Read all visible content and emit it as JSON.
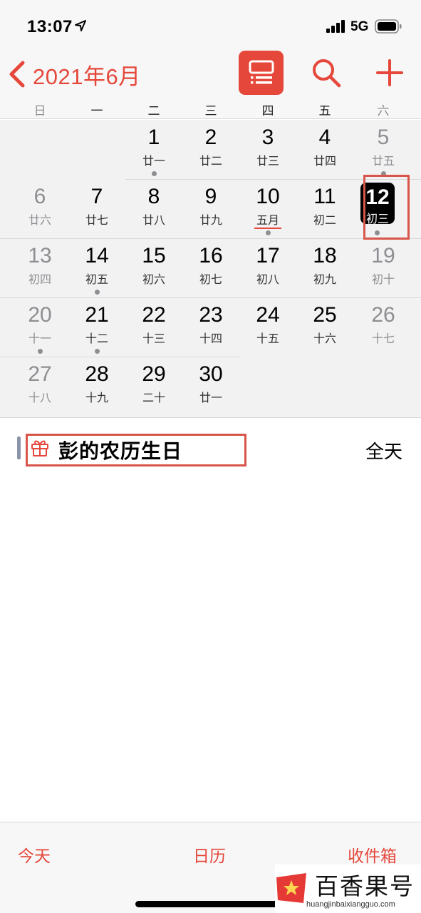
{
  "status": {
    "time": "13:07",
    "network": "5G",
    "icons": [
      "location-arrow-icon",
      "signal-bars-icon",
      "battery-icon"
    ]
  },
  "nav": {
    "title": "2021年6月",
    "icons": [
      "chevron-left-icon",
      "list-view-icon",
      "search-icon",
      "plus-icon"
    ]
  },
  "colors": {
    "accent": "#e5473a",
    "annotation": "#d9544a",
    "today_bg": "#000000",
    "weekend_text": "#8e8e93"
  },
  "weekdays": [
    "日",
    "一",
    "二",
    "三",
    "四",
    "五",
    "六"
  ],
  "days": [
    {
      "d": "1",
      "l": "廿一",
      "dot": true
    },
    {
      "d": "2",
      "l": "廿二"
    },
    {
      "d": "3",
      "l": "廿三"
    },
    {
      "d": "4",
      "l": "廿四"
    },
    {
      "d": "5",
      "l": "廿五",
      "dot": true
    },
    {
      "d": "6",
      "l": "廿六"
    },
    {
      "d": "7",
      "l": "廿七"
    },
    {
      "d": "8",
      "l": "廿八"
    },
    {
      "d": "9",
      "l": "廿九"
    },
    {
      "d": "10",
      "l": "五月",
      "dot": true,
      "underline": true
    },
    {
      "d": "11",
      "l": "初二"
    },
    {
      "d": "12",
      "l": "初三",
      "dot": true,
      "today": true
    },
    {
      "d": "13",
      "l": "初四"
    },
    {
      "d": "14",
      "l": "初五",
      "dot": true
    },
    {
      "d": "15",
      "l": "初六"
    },
    {
      "d": "16",
      "l": "初七"
    },
    {
      "d": "17",
      "l": "初八"
    },
    {
      "d": "18",
      "l": "初九"
    },
    {
      "d": "19",
      "l": "初十"
    },
    {
      "d": "20",
      "l": "十一",
      "dot": true
    },
    {
      "d": "21",
      "l": "十二",
      "dot": true
    },
    {
      "d": "22",
      "l": "十三"
    },
    {
      "d": "23",
      "l": "十四"
    },
    {
      "d": "24",
      "l": "十五"
    },
    {
      "d": "25",
      "l": "十六"
    },
    {
      "d": "26",
      "l": "十七"
    },
    {
      "d": "27",
      "l": "十八"
    },
    {
      "d": "28",
      "l": "十九"
    },
    {
      "d": "29",
      "l": "二十"
    },
    {
      "d": "30",
      "l": "廿一"
    }
  ],
  "event": {
    "icon": "gift-icon",
    "title": "彭的农历生日",
    "time": "全天"
  },
  "tabs": {
    "today": "今天",
    "calendars": "日历",
    "inbox": "收件箱"
  },
  "watermark": {
    "title": "百香果号",
    "url": "huangjinbaixiangguo.com",
    "icon": "star-logo-icon"
  }
}
